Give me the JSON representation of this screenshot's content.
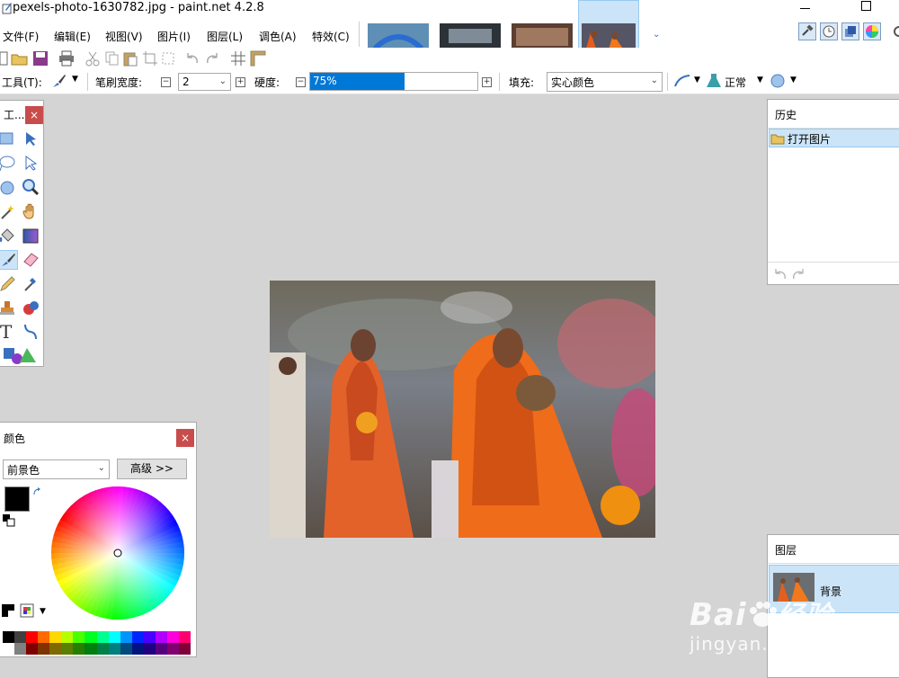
{
  "window": {
    "title": "pexels-photo-1630782.jpg - paint.net 4.2.8"
  },
  "menu": [
    {
      "label": "文件(F)"
    },
    {
      "label": "编辑(E)"
    },
    {
      "label": "视图(V)"
    },
    {
      "label": "图片(I)"
    },
    {
      "label": "图层(L)"
    },
    {
      "label": "调色(A)"
    },
    {
      "label": "特效(C)"
    }
  ],
  "toolbar2": {
    "tool_label": "工具(T):",
    "brush_width_label": "笔刷宽度:",
    "brush_width_value": "2",
    "hardness_label": "硬度:",
    "hardness_value": "75%",
    "hardness_fraction": 0.75,
    "fill_label": "填充:",
    "fill_value": "实心颜色",
    "blend_value": "正常"
  },
  "tools_panel": {
    "title": "工..."
  },
  "history_panel": {
    "title": "历史",
    "items": [
      {
        "label": "打开图片"
      }
    ]
  },
  "colors_panel": {
    "title": "颜色",
    "mode_value": "前景色",
    "advanced_label": "高级 >>",
    "primary": "#000000",
    "secondary": "#ffffff",
    "palette_top": [
      "#000000",
      "#404040",
      "#ff0000",
      "#ff6a00",
      "#ffd800",
      "#b6ff00",
      "#4cff00",
      "#00ff21",
      "#00ff90",
      "#00ffff",
      "#0094ff",
      "#0026ff",
      "#4800ff",
      "#b200ff",
      "#ff00dc",
      "#ff006e"
    ],
    "palette_bottom": [
      "#ffffff",
      "#808080",
      "#7f0000",
      "#7f3300",
      "#7f6a00",
      "#5b7f00",
      "#267f00",
      "#007f0e",
      "#007f46",
      "#007f7f",
      "#004a7f",
      "#00137f",
      "#21007f",
      "#57007f",
      "#7f006e",
      "#7f0037"
    ]
  },
  "layers_panel": {
    "title": "图层",
    "layer_name": "背景"
  },
  "watermark": {
    "brand": "Bai",
    "brand_suffix": "经验",
    "url": "jingyan.baidu.com"
  },
  "colors": {
    "accent": "#0078d7",
    "close": "#c94c4c",
    "selection": "#cce4f7"
  }
}
